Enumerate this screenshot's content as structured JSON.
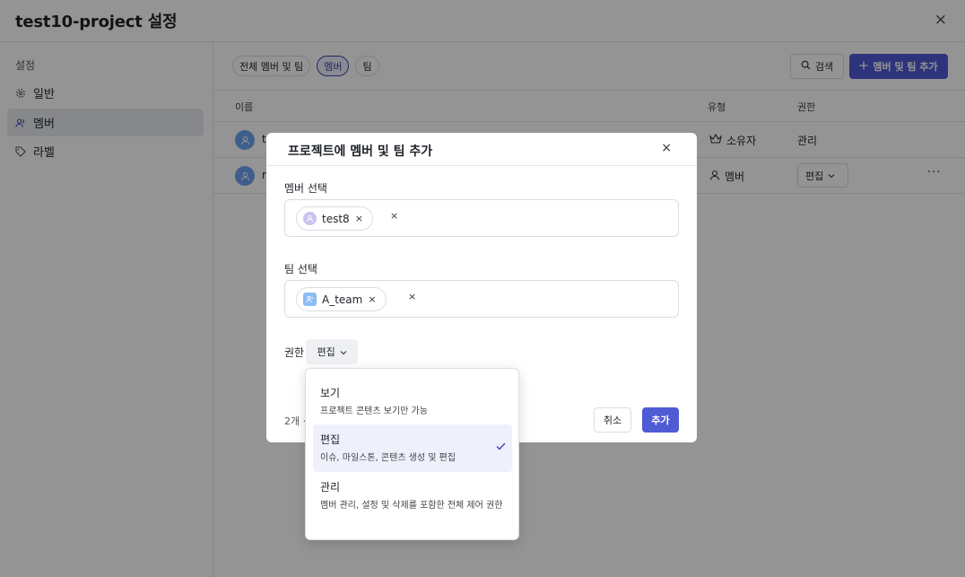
{
  "header": {
    "title": "test10-project 설정",
    "close_icon": "×"
  },
  "sidebar": {
    "heading": "설정",
    "items": [
      {
        "label": "일반",
        "icon": "gear-icon"
      },
      {
        "label": "멤버",
        "icon": "users-icon"
      },
      {
        "label": "라벨",
        "icon": "tag-icon"
      }
    ]
  },
  "filters": {
    "all": "전체 멤버 및 팀",
    "members": "멤버",
    "teams": "팀"
  },
  "toolbar": {
    "search_label": "검색",
    "add_label": "멤버 및 팀 추가"
  },
  "table": {
    "columns": {
      "name": "이름",
      "type": "유형",
      "permission": "권한"
    },
    "rows": [
      {
        "name": "t",
        "type": "소유자",
        "permission": "관리"
      },
      {
        "name": "r",
        "type": "멤버",
        "permission": "편집",
        "more": "···"
      }
    ]
  },
  "modal": {
    "title": "프로젝트에 멤버 및 팀 추가",
    "member_label": "멤버 선택",
    "member_tag": "test8",
    "team_label": "팀 선택",
    "team_tag": "A_team",
    "permission_label": "권한",
    "permission_value": "편집",
    "footer_count": "2개 ·",
    "cancel_label": "취소",
    "confirm_label": "추가"
  },
  "menu": {
    "options": [
      {
        "title": "보기",
        "desc": "프로젝트 콘텐츠 보기만 가능"
      },
      {
        "title": "편집",
        "desc": "이슈, 마일스톤, 콘텐츠 생성 및 편집",
        "selected": true
      },
      {
        "title": "관리",
        "desc": "멤버 관리, 설정 및 삭제를 포함한 전체 제어 권한"
      }
    ]
  },
  "colors": {
    "accent": "#4f5bd5",
    "overlay": "rgba(0,0,0,0.42)"
  }
}
